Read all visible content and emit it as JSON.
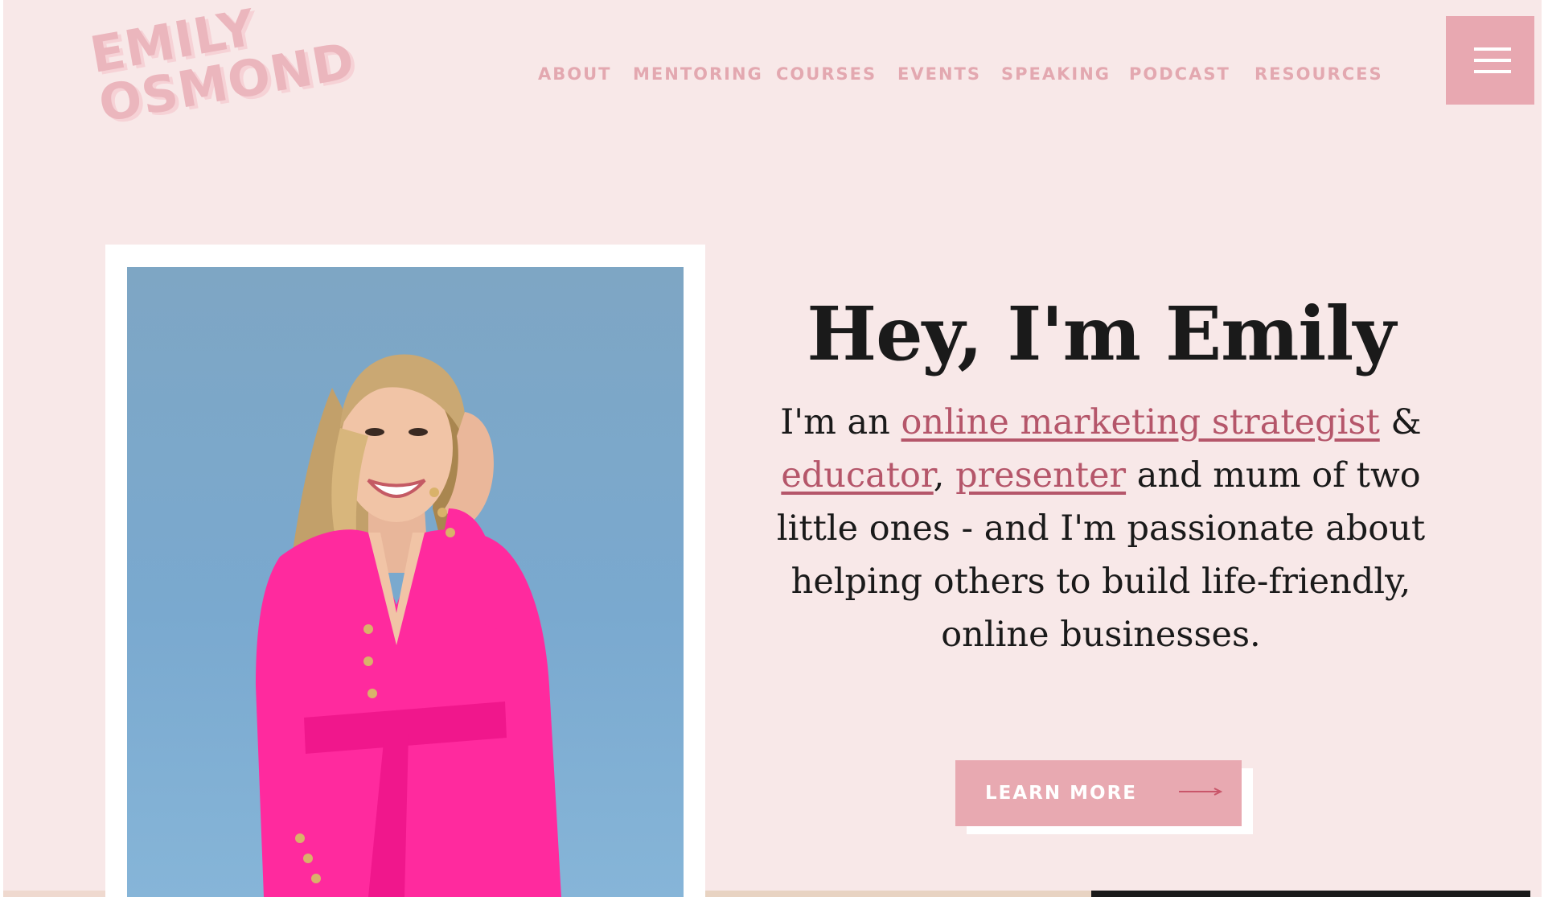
{
  "brand": {
    "line1": "EMILY",
    "line2": "OSMOND"
  },
  "nav": [
    {
      "label": "ABOUT"
    },
    {
      "label": "MENTORING"
    },
    {
      "label": "COURSES"
    },
    {
      "label": "EVENTS"
    },
    {
      "label": "SPEAKING"
    },
    {
      "label": "PODCAST"
    },
    {
      "label": "RESOURCES"
    }
  ],
  "hero": {
    "title": "Hey, I'm Emily",
    "intro_prefix": "I'm an ",
    "link_marketing": "online marketing strategist",
    "amp": " & ",
    "link_educator": "educator",
    "comma": ",",
    "space": " ",
    "link_presenter": "presenter",
    "intro_suffix": " and mum of two little ones - and I'm passionate about helping others to build life-friendly, online businesses.",
    "cta_label": "LEARN MORE"
  },
  "colors": {
    "background": "#f8e8e8",
    "accent_pink": "#e8a9b1",
    "link": "#b5566a",
    "text": "#1a1a1a",
    "suit": "#ff2a9e",
    "photo_bg": "#7aa9cf"
  },
  "icons": {
    "menu": "hamburger-icon",
    "cta": "arrow-right-icon"
  }
}
